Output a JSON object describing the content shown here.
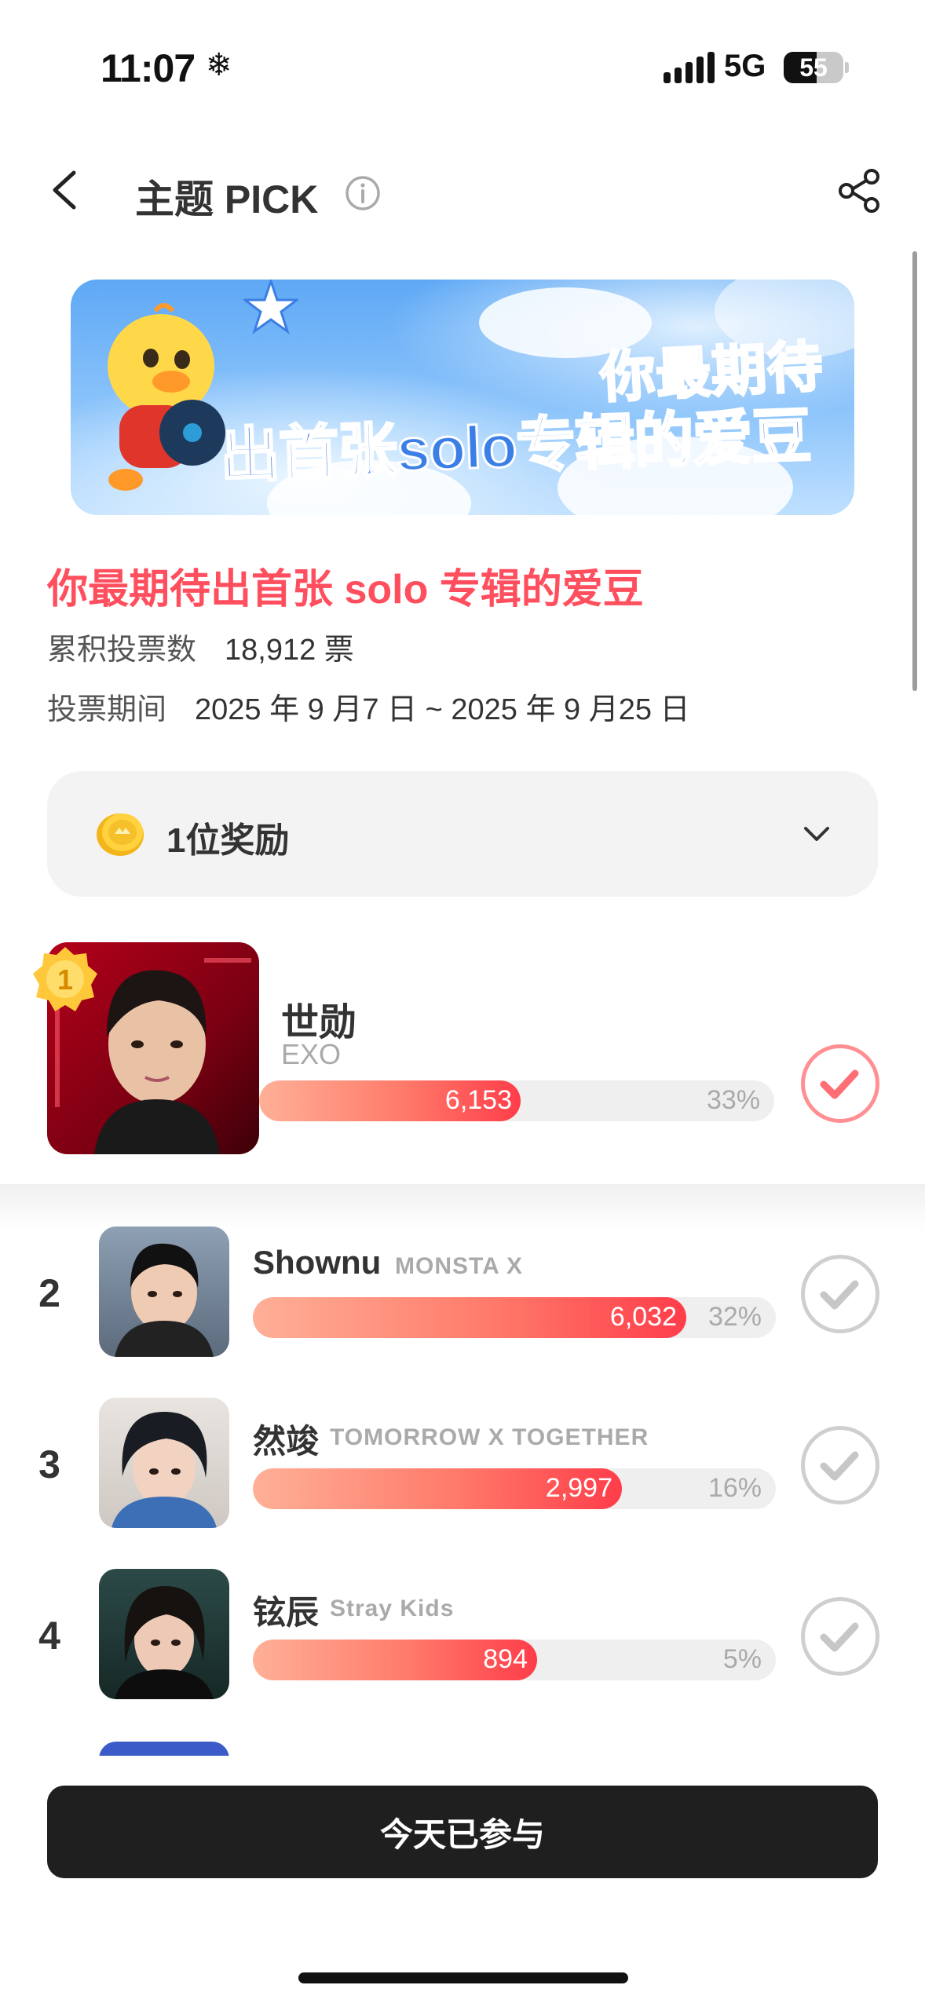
{
  "status": {
    "time": "11:07",
    "network": "5G",
    "battery": "55",
    "battery_level": 0.55
  },
  "header": {
    "title": "主题 PICK"
  },
  "banner": {
    "line1": "你最期待",
    "line2": "出首张solo专辑的爱豆"
  },
  "topic": {
    "title": "你最期待出首张 solo 专辑的爱豆",
    "votes_label": "累积投票数",
    "votes_value": "18,912 票",
    "period_label": "投票期间",
    "period_value": "2025 年 9 月7 日 ~ 2025 年 9 月25 日"
  },
  "reward": {
    "label": "1位奖励"
  },
  "ranking": [
    {
      "rank": "1",
      "name": "世勋",
      "group": "EXO",
      "votes": "6,153",
      "percent": "33%",
      "fill": 0.33
    },
    {
      "rank": "2",
      "name": "Shownu",
      "group": "MONSTA X",
      "votes": "6,032",
      "percent": "32%",
      "fill": 0.32
    },
    {
      "rank": "3",
      "name": "然竣",
      "group": "TOMORROW X TOGETHER",
      "votes": "2,997",
      "percent": "16%",
      "fill": 0.16
    },
    {
      "rank": "4",
      "name": "铉辰",
      "group": "Stray Kids",
      "votes": "894",
      "percent": "5%",
      "fill": 0.05
    }
  ],
  "footer": {
    "button_label": "今天已参与"
  },
  "colors": {
    "accent": "#ff4f5e",
    "bar_start": "#ffb097",
    "bar_end": "#ff3d4a",
    "button": "#1f1f1f"
  }
}
